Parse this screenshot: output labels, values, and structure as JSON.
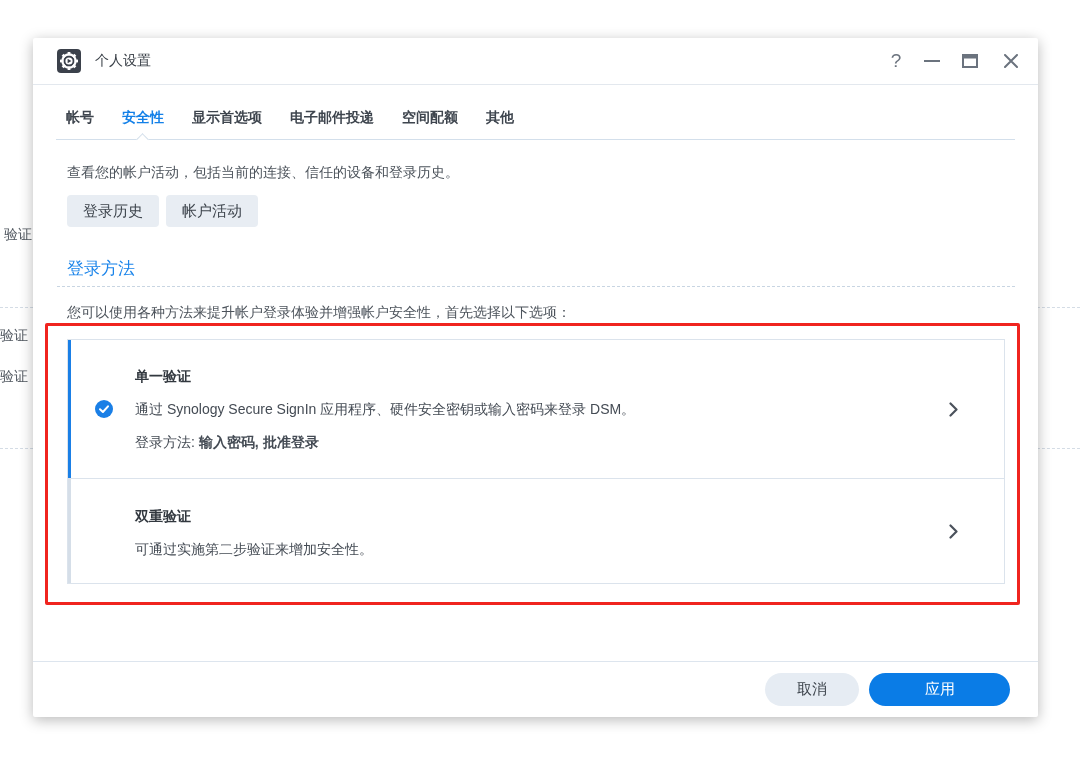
{
  "background": {
    "texts": [
      "验证",
      "验证",
      "验证"
    ]
  },
  "window": {
    "title": "个人设置",
    "help": "?"
  },
  "tabs": [
    {
      "label": "帐号",
      "selected": false
    },
    {
      "label": "安全性",
      "selected": true
    },
    {
      "label": "显示首选项",
      "selected": false
    },
    {
      "label": "电子邮件投递",
      "selected": false
    },
    {
      "label": "空间配额",
      "selected": false
    },
    {
      "label": "其他",
      "selected": false
    }
  ],
  "activity": {
    "description": "查看您的帐户活动，包括当前的连接、信任的设备和登录历史。",
    "buttons": [
      "登录历史",
      "帐户活动"
    ]
  },
  "login_method": {
    "heading": "登录方法",
    "intro": "您可以使用各种方法来提升帐户登录体验并增强帐户安全性，首先选择以下选项：",
    "highlighted": true,
    "options": [
      {
        "title": "单一验证",
        "description": "通过 Synology Secure SignIn 应用程序、硬件安全密钥或输入密码来登录 DSM。",
        "detail": "登录方法: **输入密码, 批准登录**",
        "selected": true
      },
      {
        "title": "双重验证",
        "description": "可通过实施第二步验证来增加安全性。",
        "selected": false
      }
    ]
  },
  "footer": {
    "buttons": [
      {
        "label": "取消",
        "kind": "secondary"
      },
      {
        "label": "应用",
        "kind": "primary"
      }
    ]
  }
}
